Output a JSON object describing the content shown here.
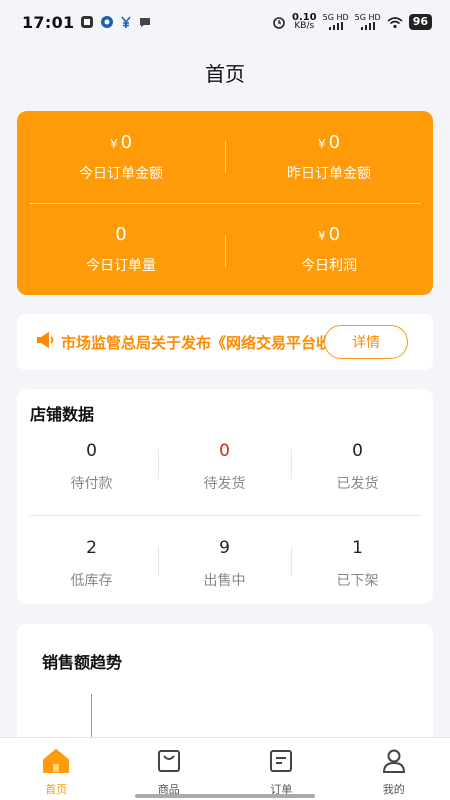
{
  "status_bar": {
    "time": "17:01",
    "speed_value": "0.10",
    "speed_unit": "KB/s",
    "net1": "5G HD",
    "net2": "5G HD",
    "battery": "96"
  },
  "page": {
    "title": "首页"
  },
  "summary": {
    "currency": "¥",
    "today_amount": "0",
    "today_amount_label": "今日订单金额",
    "yesterday_amount": "0",
    "yesterday_amount_label": "昨日订单金额",
    "today_count": "0",
    "today_count_label": "今日订单量",
    "today_profit": "0",
    "today_profit_label": "今日利润"
  },
  "notice": {
    "text": "市场监管总局关于发布《网络交易平台收费行为合规指南》",
    "detail_label": "详情"
  },
  "store": {
    "title": "店铺数据",
    "stats": [
      {
        "value": "0",
        "label": "待付款"
      },
      {
        "value": "0",
        "label": "待发货"
      },
      {
        "value": "0",
        "label": "已发货"
      },
      {
        "value": "2",
        "label": "低库存"
      },
      {
        "value": "9",
        "label": "出售中"
      },
      {
        "value": "1",
        "label": "已下架"
      }
    ]
  },
  "trend": {
    "title": "销售额趋势"
  },
  "tabbar": {
    "items": [
      {
        "label": "首页",
        "icon": "home-icon"
      },
      {
        "label": "商品",
        "icon": "bag-icon"
      },
      {
        "label": "订单",
        "icon": "order-icon"
      },
      {
        "label": "我的",
        "icon": "user-icon"
      }
    ],
    "active_color": "#ff9a08"
  },
  "colors": {
    "accent": "#ff9a08",
    "alert": "#d42a1e"
  }
}
